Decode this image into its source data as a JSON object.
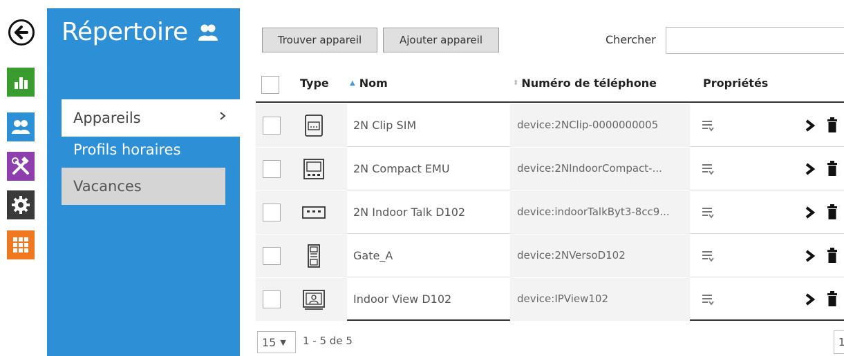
{
  "sidebar": {
    "title": "Répertoire",
    "items": [
      {
        "label": "Appareils"
      },
      {
        "label": "Profils horaires"
      },
      {
        "label": "Vacances"
      }
    ]
  },
  "rail": {
    "icons": [
      "back-icon",
      "status-icon",
      "directory-icon",
      "hardware-icon",
      "system-icon",
      "services-icon"
    ],
    "colors": {
      "status": "#3a9b2e",
      "directory": "#2d8fd6",
      "hardware": "#8d3fae",
      "system": "#3a3a3a",
      "services": "#f07820"
    }
  },
  "toolbar": {
    "find_label": "Trouver appareil",
    "add_label": "Ajouter appareil",
    "search_label": "Chercher",
    "search_value": ""
  },
  "table": {
    "columns": {
      "type": "Type",
      "name": "Nom",
      "number": "Numéro de téléphone",
      "props": "Propriétés"
    },
    "rows": [
      {
        "icon": "clip-device-icon",
        "name": "2N Clip SIM",
        "number": "device:2NClip-0000000005"
      },
      {
        "icon": "compact-device-icon",
        "name": "2N Compact EMU",
        "number": "device:2NIndoorCompact-..."
      },
      {
        "icon": "talk-device-icon",
        "name": "2N Indoor Talk D102",
        "number": "device:indoorTalkByt3-8cc9..."
      },
      {
        "icon": "verso-device-icon",
        "name": "Gate_A",
        "number": "device:2NVersoD102"
      },
      {
        "icon": "view-device-icon",
        "name": "Indoor View D102",
        "number": "device:IPView102"
      }
    ]
  },
  "footer": {
    "per_page": "15",
    "range": "1 - 5 de 5",
    "page": "1"
  }
}
